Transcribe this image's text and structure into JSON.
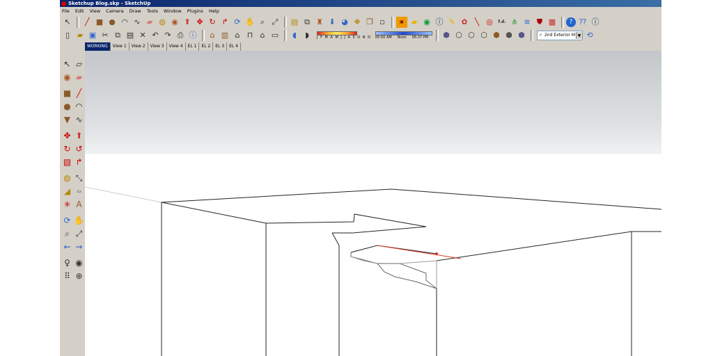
{
  "window": {
    "title": "Sketchup Blog.skp - SketchUp"
  },
  "menu": [
    "File",
    "Edit",
    "View",
    "Camera",
    "Draw",
    "Tools",
    "Window",
    "Plugins",
    "Help"
  ],
  "toolbar": {
    "shadow_months": "J F M A M J J A S O N D",
    "time_start": "05:50 AM",
    "time_noon": "Noon",
    "time_end": "05:37 PM",
    "scene_select": "2nd Exterior M",
    "scene_check": "✓",
    "icon_fd": "f.d."
  },
  "scene_tabs": [
    "WORKING",
    "View 1",
    "View 2",
    "View 3",
    "View 4",
    "EL 1",
    "EL 2",
    "EL 3",
    "EL 4"
  ],
  "active_tab": "WORKING"
}
